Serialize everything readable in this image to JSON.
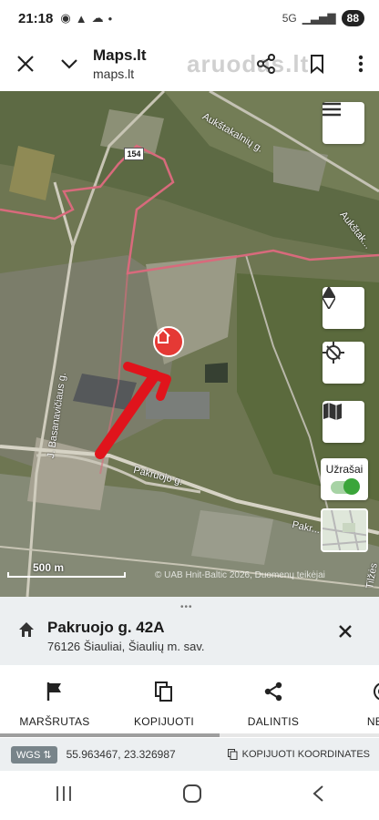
{
  "status": {
    "time": "21:18",
    "battery": "88",
    "network": "5G"
  },
  "top_bar": {
    "title": "Maps.lt",
    "subtitle": "maps.lt",
    "watermark": "aruodas.lt"
  },
  "map": {
    "road_number": "154",
    "streets": [
      "Aukštakalnių g.",
      "Aukštak...",
      "J. Basanavičiaus g.",
      "Pakruojo g.",
      "Pakr...",
      "Tilžės"
    ],
    "notes_label": "Užrašai",
    "notes_enabled": true,
    "scale_label": "500 m",
    "copyright": "© UAB Hnit-Baltic 2026, Duomenų teikėjai"
  },
  "place": {
    "name": "Pakruojo g. 42A",
    "address": "76126 Šiauliai, Šiaulių m. sav."
  },
  "actions": [
    {
      "label": "MARŠRUTAS",
      "icon": "flag-icon"
    },
    {
      "label": "KOPIJUOTI",
      "icon": "copy-icon"
    },
    {
      "label": "DALINTIS",
      "icon": "share-icon"
    },
    {
      "label": "NETO",
      "icon": "nearby-icon"
    }
  ],
  "coords": {
    "system": "WGS",
    "value": "55.963467, 23.326987",
    "copy_label": "KOPIJUOTI KOORDINATES"
  },
  "colors": {
    "marker": "#e53935",
    "arrow": "#e0141c",
    "panel": "#eceff1",
    "toggle": "#3aa53a"
  }
}
